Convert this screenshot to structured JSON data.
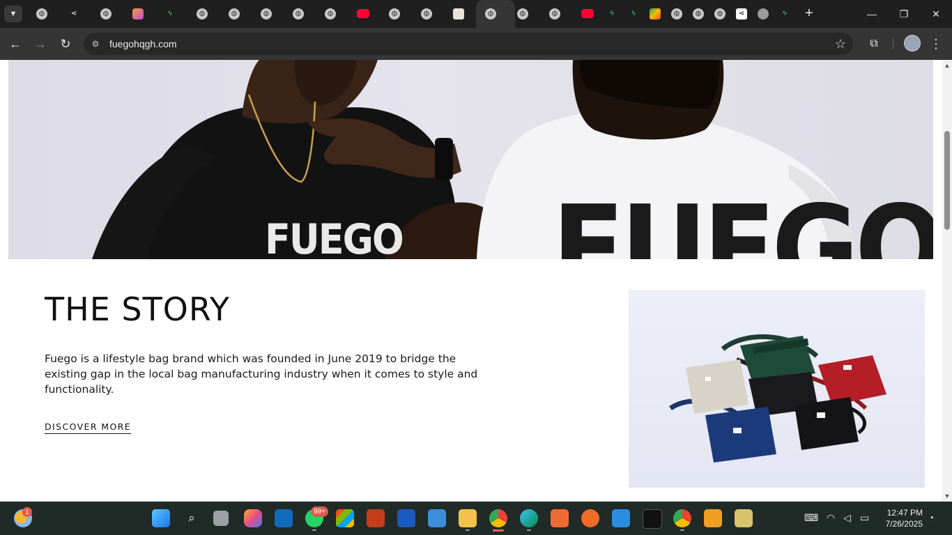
{
  "browser": {
    "tab_count": 24,
    "url": "fuegohqgh.com",
    "window_controls": {
      "minimize": "—",
      "maximize": "❐",
      "close": "✕"
    },
    "new_tab": "+"
  },
  "page": {
    "hero_shirt_text_left": "FUEGO",
    "hero_shirt_text_right": "FUEGO",
    "story": {
      "title": "THE STORY",
      "body": "Fuego is a lifestyle bag brand which was founded in June 2019 to bridge the existing gap in the local bag manufacturing industry when it comes to style and functionality.",
      "cta": "DISCOVER MORE"
    }
  },
  "taskbar": {
    "weather_badge": "1",
    "whatsapp_badge": "99+",
    "time": "12:47 PM",
    "date": "7/26/2025"
  },
  "colors": {
    "tab_strip": "#1f1f1f",
    "toolbar": "#353535",
    "taskbar": "#202a27",
    "page_bg": "#ffffff",
    "text": "#111111",
    "badge": "#e05b4d"
  }
}
